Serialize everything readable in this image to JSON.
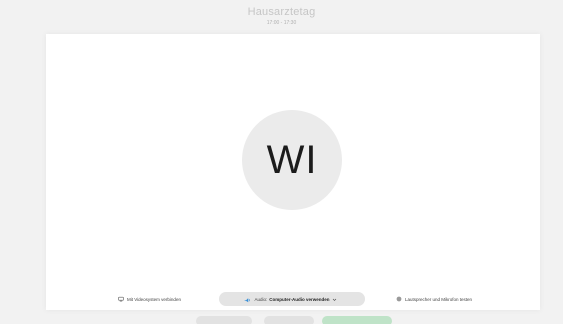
{
  "meeting": {
    "title": "Hausarztetag",
    "time": "17:00 - 17:30"
  },
  "avatar": {
    "initials": "WI"
  },
  "bottom_bar": {
    "video_system_label": "Mit Videosystem verbinden",
    "audio_prefix": "Audio:",
    "audio_value": "Computer-Audio verwenden",
    "speaker_share_label": "Lautsprecher und Mikrofon testen"
  },
  "colors": {
    "accent_green": "#bfe3c8",
    "audio_icon": "#3a8fd6"
  }
}
